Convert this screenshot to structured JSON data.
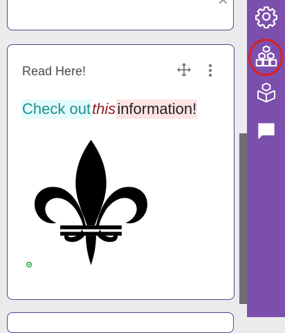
{
  "card": {
    "title": "Read Here!",
    "text_parts": [
      "Check out",
      "this",
      "information!"
    ]
  },
  "sidebar": {
    "items": [
      {
        "icon": "gear-icon"
      },
      {
        "icon": "blocks-icon",
        "selected": true
      },
      {
        "icon": "package-icon"
      },
      {
        "icon": "comment-icon"
      }
    ]
  },
  "colors": {
    "sidebar_bg": "#7c4fad",
    "card_border": "#5a3b8e",
    "selection_ring": "#e01d1d",
    "highlight_cyan": "#e3fbfb",
    "highlight_red": "#fde3e3"
  }
}
